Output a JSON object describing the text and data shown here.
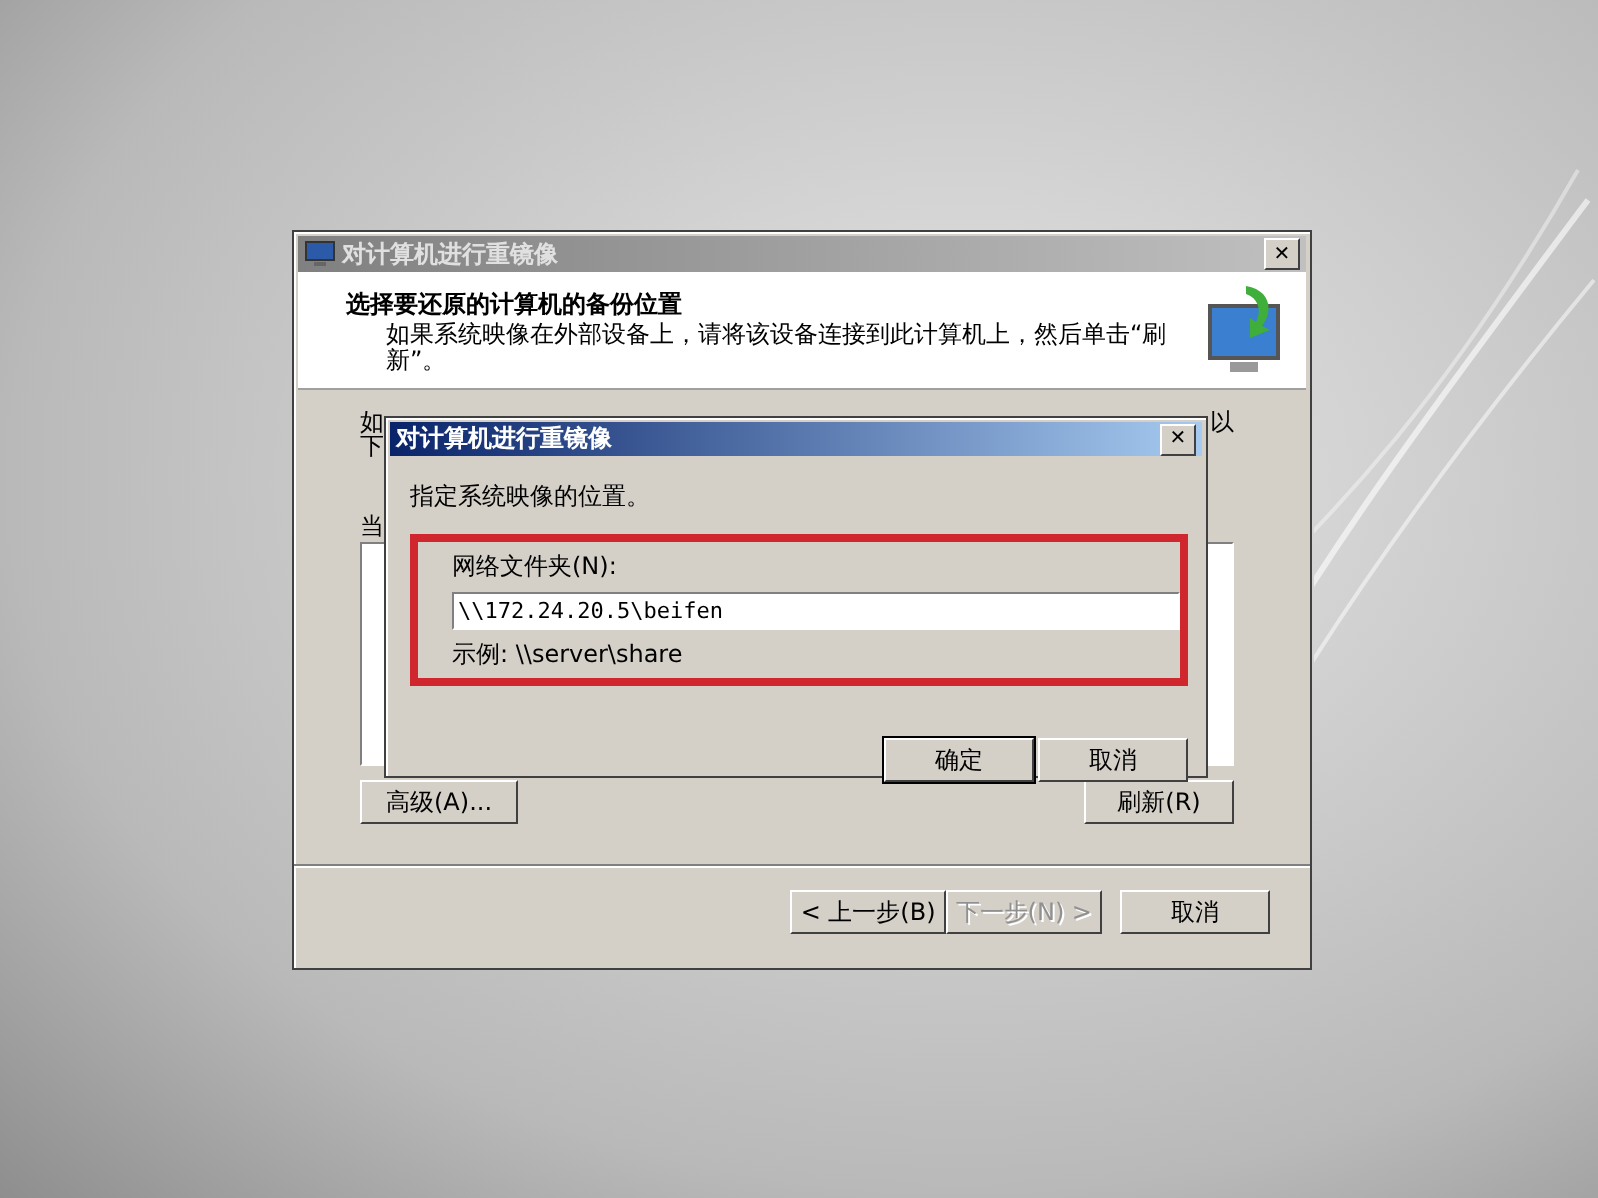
{
  "outer_window": {
    "title": "对计算机进行重镜像",
    "active": false,
    "header": {
      "heading": "选择要还原的计算机的备份位置",
      "description": "如果系统映像在外部设备上，请将该设备连接到此计算机上，然后单击“刷新”。"
    },
    "body_fragments": {
      "line_1_start": "如",
      "line_1_end": "以",
      "line_2_start": "下",
      "line_3_start": "当"
    },
    "list_buttons": [
      {
        "label": "高级(A)...",
        "disabled": false
      },
      {
        "label": "刷新(R)",
        "disabled": false
      }
    ],
    "nav_buttons": [
      {
        "label": "< 上一步(B)",
        "disabled": false
      },
      {
        "label": "下一步(N) >",
        "disabled": true
      },
      {
        "label": "取消",
        "disabled": false
      }
    ]
  },
  "inner_dialog": {
    "title": "对计算机进行重镜像",
    "active": true,
    "close": "✕",
    "instruction": "指定系统映像的位置。",
    "field": {
      "label": "网络文件夹(N):",
      "value": "\\\\172.24.20.5\\beifen",
      "example": "示例: \\\\server\\share",
      "highlighted": true
    },
    "buttons": [
      {
        "label": "确定",
        "default": true
      },
      {
        "label": "取消",
        "default": false
      }
    ]
  }
}
